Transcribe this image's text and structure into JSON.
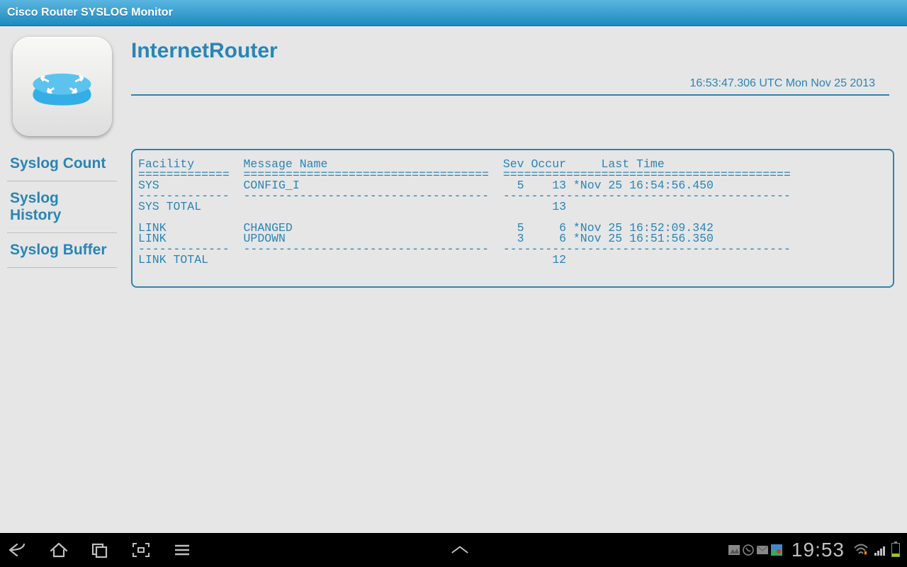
{
  "titlebar": {
    "title": "Cisco Router SYSLOG Monitor"
  },
  "page": {
    "router_name": "InternetRouter",
    "timestamp": "16:53:47.306 UTC Mon Nov 25 2013"
  },
  "nav": {
    "items": [
      {
        "label": "Syslog Count"
      },
      {
        "label": "Syslog History"
      },
      {
        "label": "Syslog Buffer"
      }
    ]
  },
  "syslog": {
    "text": "Facility       Message Name                         Sev Occur     Last Time\n=============  ===================================  =========================================\nSYS            CONFIG_I                               5    13 *Nov 25 16:54:56.450\n-------------  -----------------------------------  -----------------------------------------\nSYS TOTAL                                                  13\n\nLINK           CHANGED                                5     6 *Nov 25 16:52:09.342\nLINK           UPDOWN                                 3     6 *Nov 25 16:51:56.350\n-------------  -----------------------------------  -----------------------------------------\nLINK TOTAL                                                 12\n"
  },
  "sysbar": {
    "clock": "19:53"
  }
}
